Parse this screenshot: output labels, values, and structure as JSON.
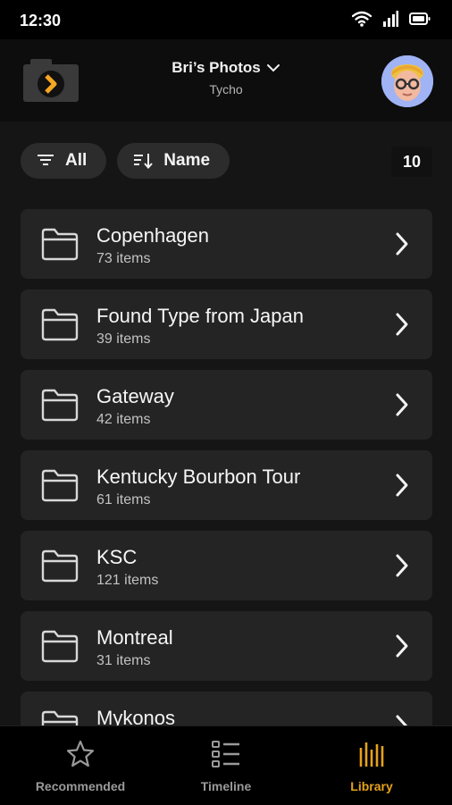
{
  "status_bar": {
    "time": "12:30"
  },
  "header": {
    "library_name": "Bri’s Photos",
    "library_source": "Tycho",
    "brand_color": "#f5a623"
  },
  "toolbar": {
    "filter_label": "All",
    "sort_label": "Name",
    "item_count": "10"
  },
  "albums": [
    {
      "name": "Copenhagen",
      "count": "73 items"
    },
    {
      "name": "Found Type from Japan",
      "count": "39 items"
    },
    {
      "name": "Gateway",
      "count": "42 items"
    },
    {
      "name": "Kentucky Bourbon Tour",
      "count": "61 items"
    },
    {
      "name": "KSC",
      "count": "121 items"
    },
    {
      "name": "Montreal",
      "count": "31 items"
    },
    {
      "name": "Mykonos",
      "count": ""
    }
  ],
  "bottom_nav": {
    "recommended": "Recommended",
    "timeline": "Timeline",
    "library": "Library",
    "active_color": "#e6a21a",
    "inactive_color": "#9a9a9a"
  }
}
